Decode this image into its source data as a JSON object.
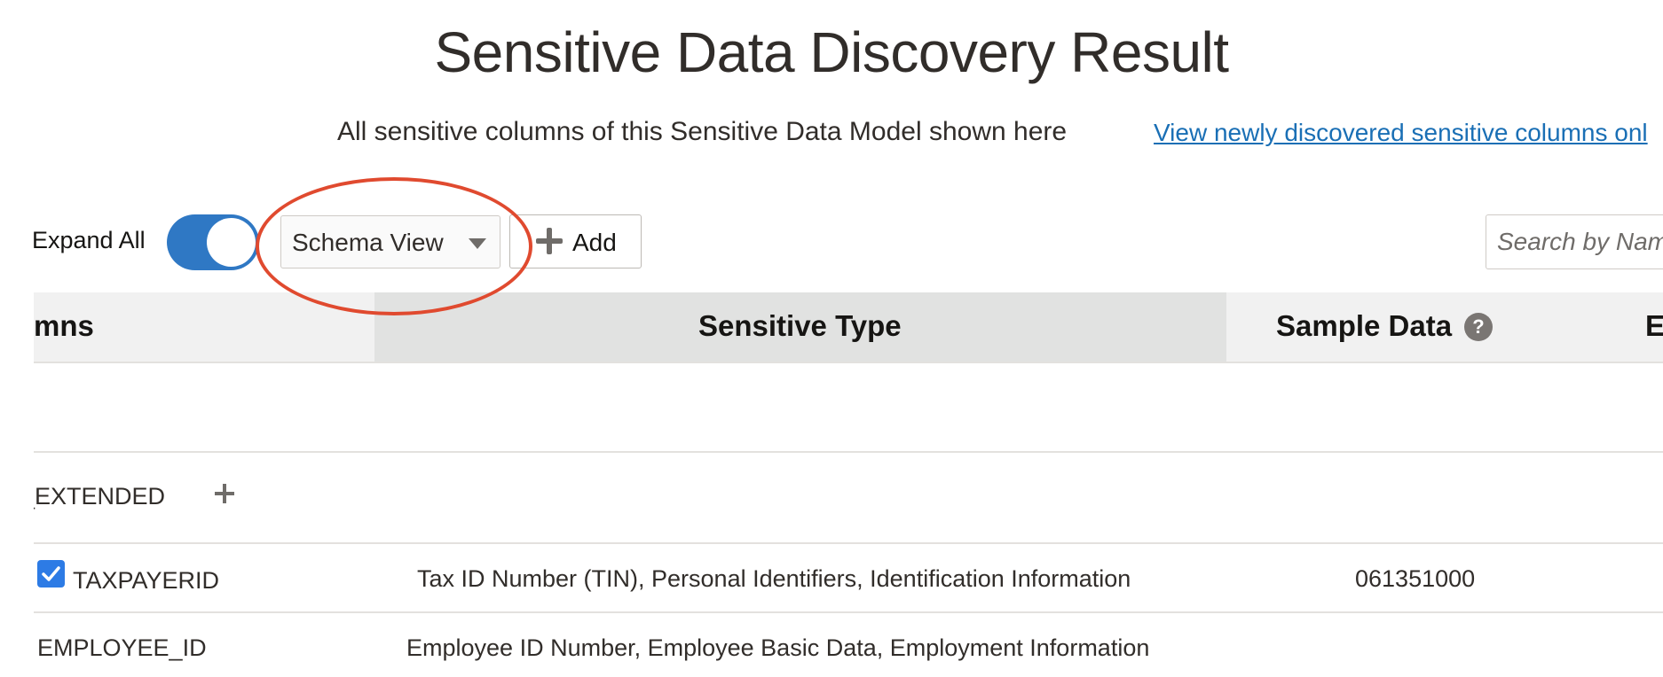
{
  "page": {
    "title": "Sensitive Data Discovery Result",
    "subtitle": "All sensitive columns of this Sensitive Data Model shown here",
    "new_columns_link": "View newly discovered sensitive columns onl"
  },
  "toolbar": {
    "expand_all_label": "Expand All",
    "expand_all_on": true,
    "view_select_value": "Schema View",
    "add_label": "Add",
    "search_placeholder": "Search by Nam"
  },
  "table": {
    "columns": [
      "mns",
      "Sensitive Type",
      "Sample Data",
      "E"
    ],
    "help_symbol": "?",
    "rows": [
      {
        "name": "",
        "sensitive_type": "",
        "sample_data": ""
      },
      {
        "name": "_EXTENDED",
        "sensitive_type": "",
        "sample_data": ""
      },
      {
        "name": "TAXPAYERID",
        "checked": true,
        "sensitive_type": "Tax ID Number (TIN), Personal Identifiers, Identification Information",
        "sample_data": "061351000"
      },
      {
        "name": "EMPLOYEE_ID",
        "sensitive_type": "Employee ID Number, Employee Basic Data, Employment Information",
        "sample_data": ""
      }
    ]
  },
  "colors": {
    "accent": "#2f78c4",
    "link": "#1a6fb5",
    "highlight_ellipse": "#e04a2f",
    "checkbox": "#2d7be5"
  },
  "icons": [
    "caret-down-icon",
    "plus-icon",
    "help-icon",
    "checkmark-icon",
    "add-row-icon"
  ]
}
